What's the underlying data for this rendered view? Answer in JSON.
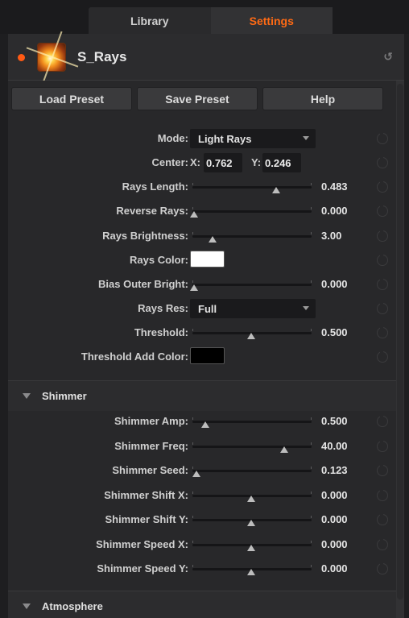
{
  "tabs": [
    {
      "label": "Library",
      "active": false
    },
    {
      "label": "Settings",
      "active": true
    }
  ],
  "header": {
    "title": "S_Rays",
    "reset_icon": "reset-icon",
    "thumbnail_icon": "rays-thumbnail-icon"
  },
  "buttons": {
    "load": "Load Preset",
    "save": "Save Preset",
    "help": "Help"
  },
  "params": {
    "mode": {
      "label": "Mode:",
      "value": "Light Rays"
    },
    "center": {
      "label": "Center:",
      "x_label": "X:",
      "x_value": "0.762",
      "y_label": "Y:",
      "y_value": "0.246"
    },
    "rays_length": {
      "label": "Rays Length:",
      "value": "0.483",
      "level": 0.72
    },
    "reverse_rays": {
      "label": "Reverse Rays:",
      "value": "0.000",
      "level": 0.0
    },
    "rays_brightness": {
      "label": "Rays Brightness:",
      "value": "3.00",
      "level": 0.16
    },
    "rays_color": {
      "label": "Rays Color:",
      "color": "#ffffff"
    },
    "bias_outer_bright": {
      "label": "Bias Outer Bright:",
      "value": "0.000",
      "level": 0.0
    },
    "rays_res": {
      "label": "Rays Res:",
      "value": "Full"
    },
    "threshold": {
      "label": "Threshold:",
      "value": "0.500",
      "level": 0.5
    },
    "threshold_add_color": {
      "label": "Threshold Add Color:",
      "color": "#000000"
    }
  },
  "shimmer": {
    "title": "Shimmer",
    "params": [
      {
        "label": "Shimmer Amp:",
        "value": "0.500",
        "level": 0.1
      },
      {
        "label": "Shimmer Freq:",
        "value": "40.00",
        "level": 0.79
      },
      {
        "label": "Shimmer Seed:",
        "value": "0.123",
        "level": 0.02
      },
      {
        "label": "Shimmer Shift X:",
        "value": "0.000",
        "level": 0.5
      },
      {
        "label": "Shimmer Shift Y:",
        "value": "0.000",
        "level": 0.5
      },
      {
        "label": "Shimmer Speed X:",
        "value": "0.000",
        "level": 0.5
      },
      {
        "label": "Shimmer Speed Y:",
        "value": "0.000",
        "level": 0.5
      }
    ]
  },
  "atmosphere": {
    "title": "Atmosphere"
  },
  "colors": {
    "accent": "#ff6a14",
    "active_dot": "#ff5a14"
  }
}
